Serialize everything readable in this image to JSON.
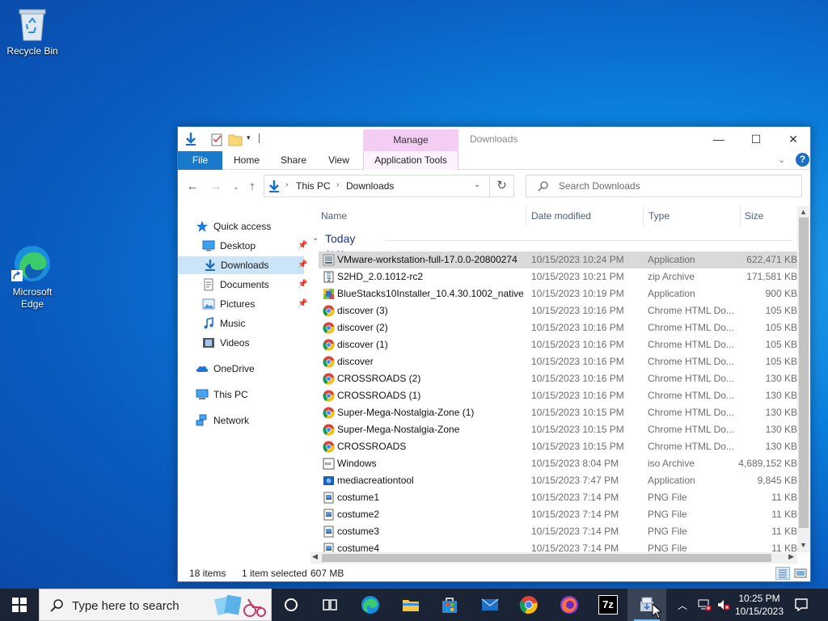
{
  "desktop": {
    "icons": [
      {
        "label": "Recycle Bin"
      },
      {
        "label": "Microsoft Edge"
      }
    ]
  },
  "window": {
    "title": "Downloads",
    "contextual_tab_group": "Manage",
    "ribbon_tabs": {
      "file": "File",
      "home": "Home",
      "share": "Share",
      "view": "View",
      "application_tools": "Application Tools"
    },
    "help_label": "?",
    "address": {
      "this_pc": "This PC",
      "current": "Downloads"
    },
    "search_placeholder": "Search Downloads",
    "nav_pane": {
      "quick_access": "Quick access",
      "desktop": "Desktop",
      "downloads": "Downloads",
      "documents": "Documents",
      "pictures": "Pictures",
      "music": "Music",
      "videos": "Videos",
      "onedrive": "OneDrive",
      "this_pc": "This PC",
      "network": "Network"
    },
    "columns": {
      "name": "Name",
      "date": "Date modified",
      "type": "Type",
      "size": "Size"
    },
    "group_label": "Today (18)",
    "files": [
      {
        "name": "VMware-workstation-full-17.0.0-20800274",
        "date": "10/15/2023 10:24 PM",
        "type": "Application",
        "size": "622,471 KB",
        "icon": "vmware-installer-icon"
      },
      {
        "name": "S2HD_2.0.1012-rc2",
        "date": "10/15/2023 10:21 PM",
        "type": "zip Archive",
        "size": "171,581 KB",
        "icon": "zip-archive-icon"
      },
      {
        "name": "BlueStacks10Installer_10.4.30.1002_native...",
        "date": "10/15/2023 10:19 PM",
        "type": "Application",
        "size": "900 KB",
        "icon": "bluestacks-icon"
      },
      {
        "name": "discover (3)",
        "date": "10/15/2023 10:16 PM",
        "type": "Chrome HTML Do...",
        "size": "105 KB",
        "icon": "chrome-icon"
      },
      {
        "name": "discover (2)",
        "date": "10/15/2023 10:16 PM",
        "type": "Chrome HTML Do...",
        "size": "105 KB",
        "icon": "chrome-icon"
      },
      {
        "name": "discover (1)",
        "date": "10/15/2023 10:16 PM",
        "type": "Chrome HTML Do...",
        "size": "105 KB",
        "icon": "chrome-icon"
      },
      {
        "name": "discover",
        "date": "10/15/2023 10:16 PM",
        "type": "Chrome HTML Do...",
        "size": "105 KB",
        "icon": "chrome-icon"
      },
      {
        "name": "CROSSROADS (2)",
        "date": "10/15/2023 10:16 PM",
        "type": "Chrome HTML Do...",
        "size": "130 KB",
        "icon": "chrome-icon"
      },
      {
        "name": "CROSSROADS (1)",
        "date": "10/15/2023 10:16 PM",
        "type": "Chrome HTML Do...",
        "size": "130 KB",
        "icon": "chrome-icon"
      },
      {
        "name": "Super-Mega-Nostalgia-Zone (1)",
        "date": "10/15/2023 10:15 PM",
        "type": "Chrome HTML Do...",
        "size": "130 KB",
        "icon": "chrome-icon"
      },
      {
        "name": "Super-Mega-Nostalgia-Zone",
        "date": "10/15/2023 10:15 PM",
        "type": "Chrome HTML Do...",
        "size": "130 KB",
        "icon": "chrome-icon"
      },
      {
        "name": "CROSSROADS",
        "date": "10/15/2023 10:15 PM",
        "type": "Chrome HTML Do...",
        "size": "130 KB",
        "icon": "chrome-icon"
      },
      {
        "name": "Windows",
        "date": "10/15/2023 8:04 PM",
        "type": "iso Archive",
        "size": "4,689,152 KB",
        "icon": "iso-archive-icon"
      },
      {
        "name": "mediacreationtool",
        "date": "10/15/2023 7:47 PM",
        "type": "Application",
        "size": "9,845 KB",
        "icon": "media-creation-tool-icon"
      },
      {
        "name": "costume1",
        "date": "10/15/2023 7:14 PM",
        "type": "PNG File",
        "size": "11 KB",
        "icon": "png-file-icon"
      },
      {
        "name": "costume2",
        "date": "10/15/2023 7:14 PM",
        "type": "PNG File",
        "size": "11 KB",
        "icon": "png-file-icon"
      },
      {
        "name": "costume3",
        "date": "10/15/2023 7:14 PM",
        "type": "PNG File",
        "size": "11 KB",
        "icon": "png-file-icon"
      },
      {
        "name": "costume4",
        "date": "10/15/2023 7:14 PM",
        "type": "PNG File",
        "size": "11 KB",
        "icon": "png-file-icon"
      }
    ],
    "selected_index": 0,
    "status": {
      "items": "18 items",
      "selected": "1 item selected",
      "size": "607 MB"
    }
  },
  "taskbar": {
    "search_placeholder": "Type here to search",
    "apps": [
      "cortana-icon",
      "task-view-icon",
      "edge-icon",
      "file-explorer-icon",
      "store-icon",
      "mail-icon",
      "chrome-icon",
      "firefox-icon",
      "7zip-icon",
      "installer-icon"
    ],
    "sevenzip_label": "7z",
    "time": "10:25 PM",
    "date": "10/15/2023"
  },
  "colors": {
    "accent": "#1979ca",
    "manage_tab": "#f3cdf3",
    "selection": "#d9d9d9",
    "nav_selection": "#cce4f7",
    "taskbar": "#1b2435"
  }
}
